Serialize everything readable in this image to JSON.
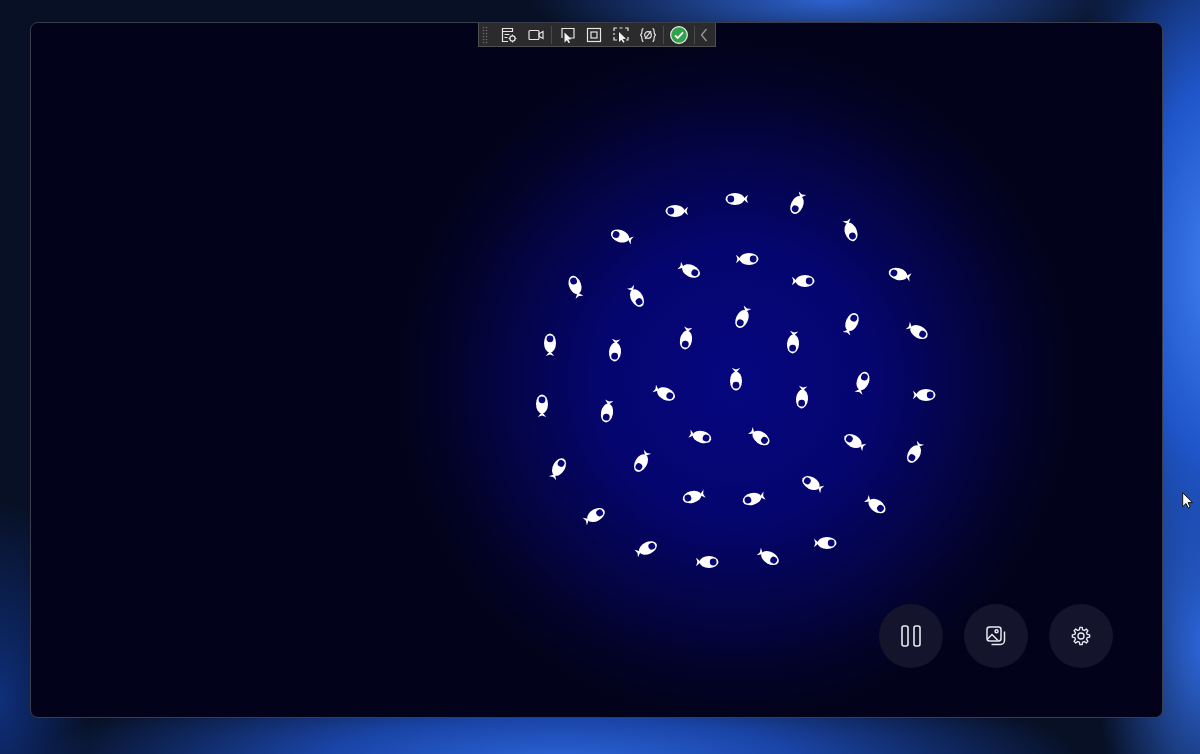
{
  "window": {
    "toolbar": [
      {
        "kind": "live-tree"
      },
      {
        "kind": "record"
      },
      {
        "kind": "select"
      },
      {
        "kind": "adorners"
      },
      {
        "kind": "track-focus"
      },
      {
        "kind": "bindings"
      },
      {
        "kind": "status-ok"
      },
      {
        "kind": "collapse"
      }
    ]
  },
  "scene": {
    "kind": "fish-school"
  },
  "controls": [
    {
      "kind": "pause"
    },
    {
      "kind": "gallery"
    },
    {
      "kind": "settings"
    }
  ]
}
